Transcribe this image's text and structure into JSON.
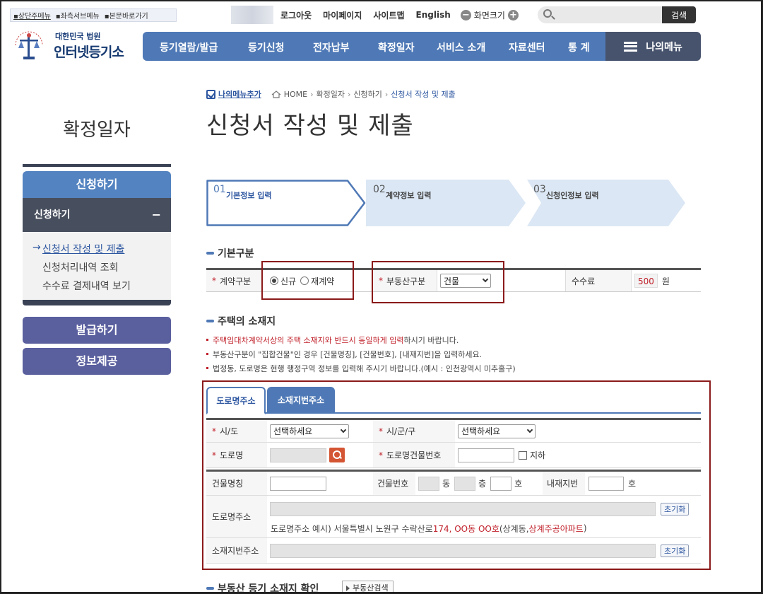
{
  "skip_nav": [
    "상단주메뉴",
    "좌측서브메뉴",
    "본문바로가기"
  ],
  "util": {
    "logout": "로그아웃",
    "mypage": "마이페이지",
    "sitemap": "사이트맵",
    "english": "English",
    "screen_size": "화면크기",
    "search_button": "검색"
  },
  "logo": {
    "line1": "대한민국 법원",
    "line2": "인터넷등기소"
  },
  "gnb": [
    "등기열람/발급",
    "등기신청",
    "전자납부",
    "확정일자",
    "서비스 소개",
    "자료센터",
    "통 계"
  ],
  "my_menu": "나의메뉴",
  "sidebar": {
    "title": "확정일자",
    "section": "신청하기",
    "sub_header": "신청하기",
    "sub_items": [
      "신청서 작성 및 제출",
      "신청처리내역 조회",
      "수수료 결제내역 보기"
    ],
    "buttons": [
      "발급하기",
      "정보제공"
    ]
  },
  "breadcrumb": {
    "add_menu": "나의메뉴추가",
    "path": [
      "HOME",
      "확정일자",
      "신청하기",
      "신청서 작성 및 제출"
    ]
  },
  "page_title": "신청서 작성 및 제출",
  "steps": [
    {
      "num": "01",
      "label": "기본정보 입력",
      "active": true
    },
    {
      "num": "02",
      "label": "계약정보 입력",
      "active": false
    },
    {
      "num": "03",
      "label": "신청인정보 입력",
      "active": false
    }
  ],
  "basic": {
    "title": "기본구분",
    "contract_type_label": "계약구분",
    "contract_options": [
      "신규",
      "재계약"
    ],
    "contract_selected": "신규",
    "property_type_label": "부동산구분",
    "property_value": "건물",
    "fee_label": "수수료",
    "fee_value": "500",
    "fee_unit": "원"
  },
  "address": {
    "title": "주택의 소재지",
    "notes": [
      {
        "red": "주택임대차계약서상의 주택 소재지와 반드시 동일하게 입력",
        "rest": "하시기 바랍니다."
      },
      {
        "red": "",
        "rest": "부동산구분이 \"집합건물\"인 경우 [건물명칭], [건물번호], [내재지번]을 입력하세요."
      },
      {
        "red": "",
        "rest": "법정동, 도로명은 현행 행정구역 정보를 입력해 주시기 바랍니다.(예시 : 인천광역시 미추홀구)"
      }
    ],
    "tabs": [
      "도로명주소",
      "소재지번주소"
    ],
    "sido_label": "시/도",
    "sido_value": "선택하세요",
    "sigungu_label": "시/군/구",
    "sigungu_value": "선택하세요",
    "road_label": "도로명",
    "road_bldg_no_label": "도로명건물번호",
    "basement_label": "지하",
    "bldg_name_label": "건물명칭",
    "bldg_no_label": "건물번호",
    "dong_unit": "동",
    "floor_unit": "층",
    "ho_unit": "호",
    "inner_lot_label": "내재지번",
    "inner_ho_unit": "호",
    "road_addr_label": "도로명주소",
    "reset_label": "초기화",
    "example_prefix": "도로명주소 예시) 서울특별시 노원구 수락산로 ",
    "example_red1": "174, OO동 OO호",
    "example_mid": "(상계동, ",
    "example_red2": "상계주공아파트",
    "example_suffix": ")",
    "lot_addr_label": "소재지번주소"
  },
  "bottom": {
    "title": "부동산 등기 소재지 확인",
    "search_button": "부동산검색"
  },
  "colors": {
    "primary_blue": "#4f79b6",
    "dark_nav": "#47536d",
    "highlight_red": "#8b1a1a",
    "side_purple": "#5a5f9e"
  }
}
